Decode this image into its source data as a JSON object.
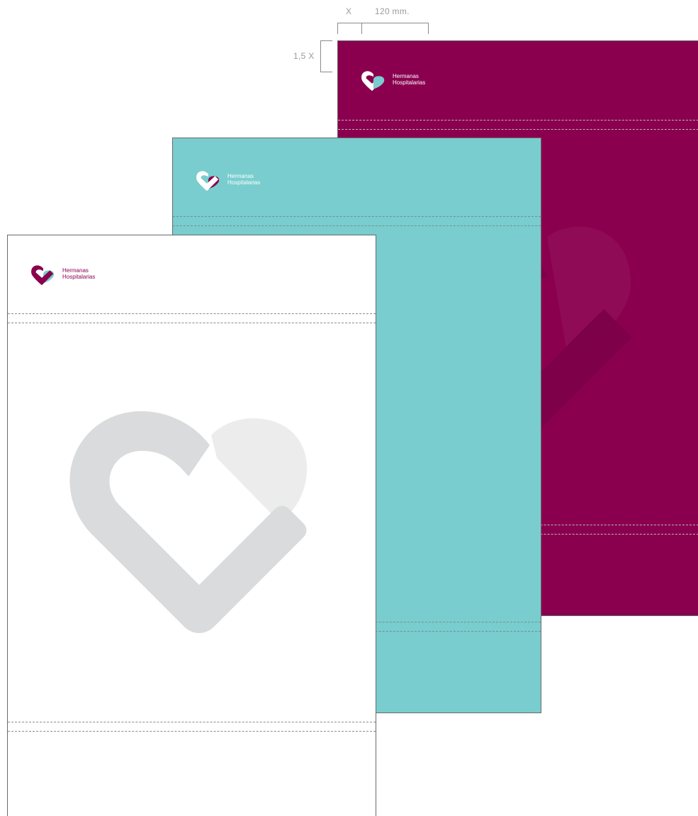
{
  "brand": {
    "line1": "Hermanas",
    "line2": "Hospitalarias"
  },
  "dimensions": {
    "margin_label": "X",
    "width_label": "120 mm.",
    "top_margin_label": "1,5 X"
  },
  "colors": {
    "magenta": "#8a004f",
    "teal": "#79cdce",
    "white": "#ffffff",
    "watermark_light": "#ececed",
    "watermark_dark": "#dadbdc"
  },
  "pages": [
    {
      "name": "magenta-page",
      "background": "#8a004f"
    },
    {
      "name": "teal-page",
      "background": "#79cdce"
    },
    {
      "name": "white-page",
      "background": "#ffffff"
    }
  ]
}
